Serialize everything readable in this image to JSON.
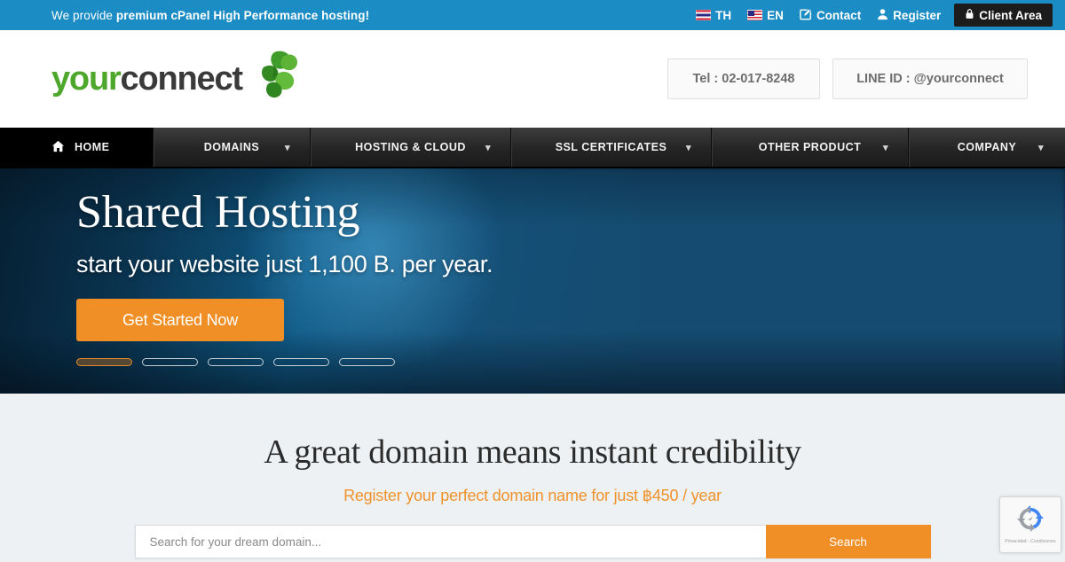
{
  "topbar": {
    "message_prefix": "We provide ",
    "message_bold": "premium cPanel High Performance hosting!",
    "lang_th": "TH",
    "lang_en": "EN",
    "contact": "Contact",
    "register": "Register",
    "client_area": "Client Area",
    "bg_color": "#1b8dc4",
    "client_area_bg": "#1c1c1c"
  },
  "header": {
    "logo_part1": "your",
    "logo_part2": "connect",
    "logo_color_1": "#4ca72b",
    "logo_color_2": "#3a3a3a",
    "tel_button": "Tel : 02-017-8248",
    "line_button": "LINE ID : @yourconnect"
  },
  "nav": {
    "items": [
      {
        "label": "HOME",
        "has_chevron": false,
        "active": true
      },
      {
        "label": "DOMAINS",
        "has_chevron": true,
        "active": false
      },
      {
        "label": "HOSTING & CLOUD",
        "has_chevron": true,
        "active": false
      },
      {
        "label": "SSL CERTIFICATES",
        "has_chevron": true,
        "active": false
      },
      {
        "label": "OTHER PRODUCT",
        "has_chevron": true,
        "active": false
      },
      {
        "label": "COMPANY",
        "has_chevron": true,
        "active": false
      }
    ]
  },
  "hero": {
    "title": "Shared Hosting",
    "subtitle": "start your website just 1,100 B. per year.",
    "cta_label": "Get Started Now",
    "cta_color": "#ef8f26",
    "slide_count": 5,
    "active_slide": 1
  },
  "domain": {
    "title": "A great domain means instant credibility",
    "subtitle": "Register your perfect domain name for just ฿450 / year",
    "subtitle_color": "#f0922b",
    "search_placeholder": "Search for your dream domain...",
    "search_value": "",
    "search_button": "Search"
  },
  "recaptcha": {
    "label": "Privacidad - Condiciones"
  }
}
